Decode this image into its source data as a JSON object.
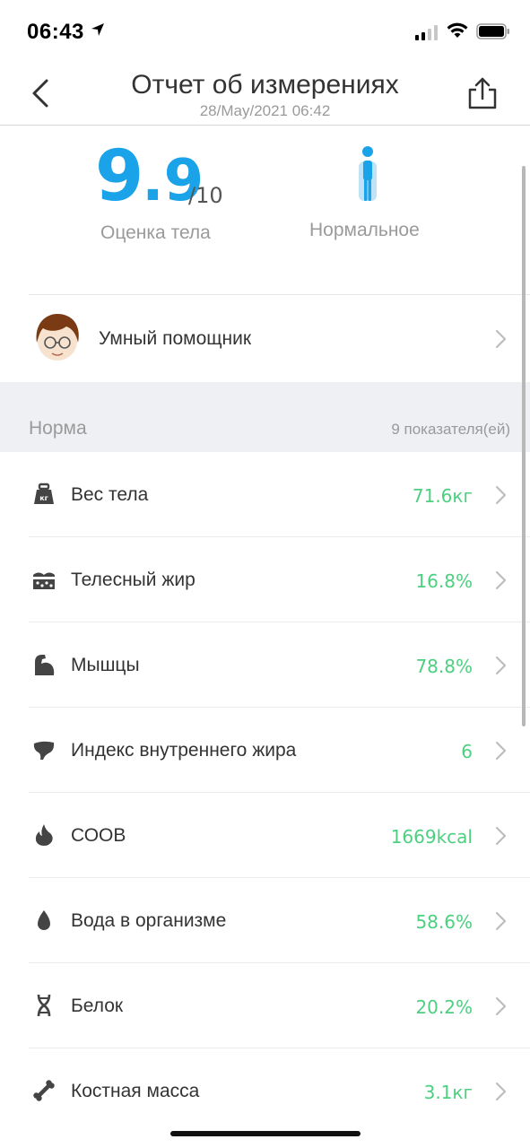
{
  "status_bar": {
    "time": "06:43",
    "icons": [
      "location-arrow-icon",
      "signal-icon",
      "wifi-icon",
      "battery-icon"
    ]
  },
  "nav": {
    "title": "Отчет об измерениях",
    "subtitle": "28/May/2021 06:42",
    "back_icon": "chevron-left-icon",
    "share_icon": "share-icon"
  },
  "score": {
    "integer": "9",
    "decimal": ".9",
    "max": "/10",
    "label": "Оценка тела",
    "body_type": "Нормальное"
  },
  "assistant": {
    "label": "Умный помощник"
  },
  "norm": {
    "title": "Норма",
    "count": "9 показателя(ей)"
  },
  "metrics": [
    {
      "icon": "weight-icon",
      "label": "Вес тела",
      "value": "71.6кг"
    },
    {
      "icon": "body-fat-icon",
      "label": "Телесный жир",
      "value": "16.8%"
    },
    {
      "icon": "muscle-icon",
      "label": "Мышцы",
      "value": "78.8%"
    },
    {
      "icon": "visceral-fat-icon",
      "label": "Индекс внутреннего жира",
      "value": "6"
    },
    {
      "icon": "flame-icon",
      "label": "СООВ",
      "value": "1669kcal"
    },
    {
      "icon": "water-drop-icon",
      "label": "Вода в организме",
      "value": "58.6%"
    },
    {
      "icon": "dna-icon",
      "label": "Белок",
      "value": "20.2%"
    },
    {
      "icon": "bone-icon",
      "label": "Костная масса",
      "value": "3.1кг"
    }
  ],
  "colors": {
    "score_blue": "#1aa3e8",
    "value_green": "#4cd080",
    "section_bg": "#eef0f4"
  }
}
